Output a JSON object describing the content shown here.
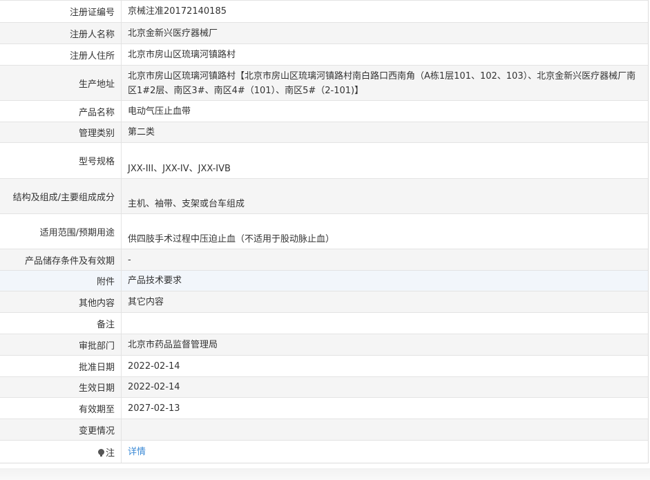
{
  "rows": [
    {
      "label": "注册证编号",
      "value": "京械注准20172140185"
    },
    {
      "label": "注册人名称",
      "value": "北京金新兴医疗器械厂"
    },
    {
      "label": "注册人住所",
      "value": "北京市房山区琉璃河镇路村"
    },
    {
      "label": "生产地址",
      "value": "北京市房山区琉璃河镇路村【北京市房山区琉璃河镇路村南白路口西南角（A栋1层101、102、103）、北京金新兴医疗器械厂南区1#2层、南区3#、南区4#（101）、南区5#（2-101)】"
    },
    {
      "label": "产品名称",
      "value": "电动气压止血带"
    },
    {
      "label": "管理类别",
      "value": "第二类"
    },
    {
      "label": "型号规格",
      "value": "JXX-III、JXX-IV、JXX-IVB"
    },
    {
      "label": "结构及组成/主要组成成分",
      "value": "主机、袖带、支架或台车组成"
    },
    {
      "label": "适用范围/预期用途",
      "value": "供四肢手术过程中压迫止血（不适用于股动脉止血）"
    },
    {
      "label": "产品储存条件及有效期",
      "value": "-"
    },
    {
      "label": "附件",
      "value": "产品技术要求"
    },
    {
      "label": "其他内容",
      "value": "其它内容"
    },
    {
      "label": "备注",
      "value": ""
    },
    {
      "label": "审批部门",
      "value": "北京市药品监督管理局"
    },
    {
      "label": "批准日期",
      "value": "2022-02-14"
    },
    {
      "label": "生效日期",
      "value": "2022-02-14"
    },
    {
      "label": "有效期至",
      "value": "2027-02-13"
    },
    {
      "label": "变更情况",
      "value": ""
    },
    {
      "label": "注",
      "value": "详情"
    }
  ],
  "icons": {
    "note": "pin-icon"
  },
  "colors": {
    "link": "#3b8ad6",
    "alt_row": "#f5f5f5",
    "border": "#e3e3e3"
  }
}
